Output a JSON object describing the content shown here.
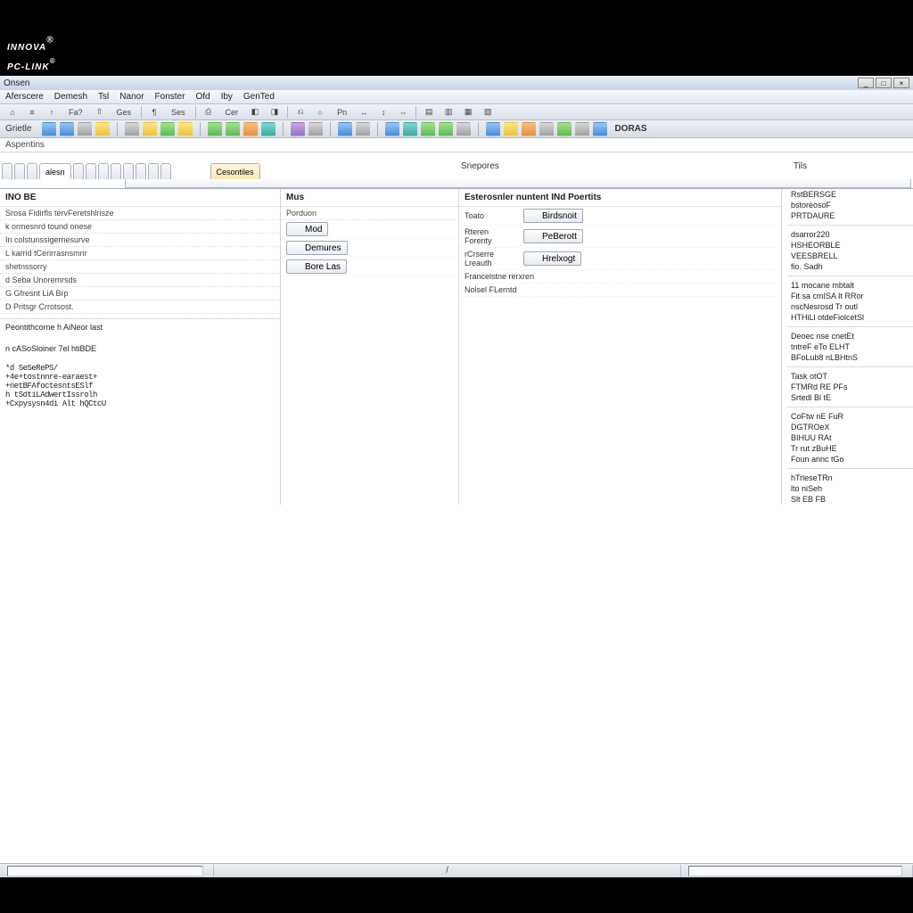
{
  "logo": {
    "line1": "INNOVA",
    "line2": "PC-LINK",
    "reg": "®",
    "sub": "®"
  },
  "window": {
    "title": "Onsen",
    "controls": {
      "min": "_",
      "max": "□",
      "close": "×"
    }
  },
  "menu": [
    "Aferscere",
    "Demesh",
    "Tsl",
    "Nanor",
    "Fonster",
    "Ofd",
    "Iby",
    "GenTed"
  ],
  "toolbar1": [
    {
      "label": "⌂"
    },
    {
      "label": "≡"
    },
    {
      "label": "↑"
    },
    {
      "label": "Fa?",
      "wide": true
    },
    {
      "label": "⇧"
    },
    {
      "label": "Ges",
      "wide": true
    },
    {
      "label": "|"
    },
    {
      "label": "¶"
    },
    {
      "label": "Ses",
      "wide": true
    },
    {
      "label": "|"
    },
    {
      "label": "⎙"
    },
    {
      "label": "Cer",
      "wide": true
    },
    {
      "label": "◧"
    },
    {
      "label": "◨"
    },
    {
      "label": "|"
    },
    {
      "label": "⎌"
    },
    {
      "label": "○"
    },
    {
      "label": "Pn",
      "wide": true
    },
    {
      "label": "↔"
    },
    {
      "label": "↕"
    },
    {
      "label": "⇔"
    },
    {
      "label": "|"
    },
    {
      "label": "▤"
    },
    {
      "label": "▥"
    },
    {
      "label": "▦"
    },
    {
      "label": "▧"
    }
  ],
  "toolbar2_label": "Grietle",
  "toolbar2_icons": [
    "i-blue",
    "i-blue",
    "i-gray",
    "i-yellow",
    "sep",
    "i-gray",
    "i-yellow",
    "i-green",
    "i-yellow",
    "sep",
    "i-green",
    "i-green",
    "i-orange",
    "i-teal",
    "sep",
    "i-purple",
    "i-gray",
    "sep",
    "i-blue",
    "i-gray",
    "sep",
    "i-blue",
    "i-teal",
    "i-green",
    "i-green",
    "i-gray",
    "sep",
    "i-blue",
    "i-yellow",
    "i-orange",
    "i-gray",
    "i-green",
    "i-gray",
    "i-blue"
  ],
  "toolbar2_end": "DORAS",
  "subheader": "Aspentins",
  "tabs": [
    {
      "label": "",
      "size": "small"
    },
    {
      "label": "",
      "size": "small"
    },
    {
      "label": "",
      "size": "small"
    },
    {
      "label": "alesn",
      "active": true
    },
    {
      "label": "",
      "size": "small"
    },
    {
      "label": "",
      "size": "small"
    },
    {
      "label": "",
      "size": "small"
    },
    {
      "label": "",
      "size": "small"
    },
    {
      "label": "",
      "size": "small"
    },
    {
      "label": "",
      "size": "small"
    },
    {
      "label": "",
      "size": "small"
    },
    {
      "label": "",
      "size": "small"
    }
  ],
  "tab_right": {
    "label": "Cesontiles",
    "highlighted": true
  },
  "col_headers": {
    "mid": "Snepores",
    "right": "Tils"
  },
  "left_panel": {
    "header": "INO BE",
    "sub": "Srosa Fidirfls tervFeretshlrisze",
    "items": [
      "k ormesnrd tound onese",
      "In colstunssigernesurve",
      "L karrid tCerirrasnsmnr",
      "shetnssorry",
      "d Seba Unoremrsds",
      "G Gfresnt LiA Brp",
      "D Pritsgr Crrotsost."
    ]
  },
  "mid1_panel": {
    "header": "Mus",
    "sub": "Porduon",
    "buttons": [
      {
        "label": "Mod",
        "color": "i-gray"
      },
      {
        "label": "Demures",
        "color": "i-green"
      },
      {
        "label": "Bore Las",
        "color": "i-teal"
      }
    ]
  },
  "mid2_panel": {
    "header": "Esterosnler nuntent INd Poertits",
    "rows": [
      {
        "l": "Toato",
        "btn": "Birdsnoit",
        "color": "i-green"
      },
      {
        "l": "Rteren Forenty",
        "btn": "PeBerott",
        "color": "i-green"
      },
      {
        "l": "rCrserre Lreauth",
        "btn": "Hrelxogt",
        "color": "i-green"
      }
    ],
    "trailing": [
      "Francelstne rerxren",
      "Nolsel FLerntd"
    ]
  },
  "right_panel": {
    "group1": [
      "RstBERSGE",
      "bstoreosoF",
      "PRTDAURE"
    ],
    "group2": [
      "dsarror220",
      "HSHEORBLE",
      "VEESBRELL",
      "fio. Sadh"
    ],
    "group3": [
      "11 mocane mbtalt",
      "Fit sa cmISA It RRor",
      "nscNesrosd Tr outl",
      "HTHiLl otdeFiolcetSl"
    ],
    "group4": [
      "Deoec nse cnetEt",
      "tntreF eTo ELHT",
      "BFoLub8 nLBHtnS"
    ],
    "group5": [
      "Task otOT",
      "FTMRd RE PFs",
      "Srtedl Bl tE"
    ],
    "group6": [
      "CoFtw nE FuR",
      "DGTROeX",
      "BIHUU RAt",
      "Tr rut zBuHE",
      "Foun annc tGo"
    ],
    "group7": [
      "hTrleseTRn",
      "lto niSeh",
      "Slt EB FB"
    ]
  },
  "lower_left": {
    "title1": "Peontithcorne h AiNeor last",
    "title2": "n cASoSloiner 7el htiBDE",
    "lines": [
      "*d SeSeRePS/",
      "+4e+tostnnre-earaest+",
      "+netBFAfoctesntsESlf",
      "h tSdtiLAdwertIssrolh",
      "+Cxpysysn4di Alt hQCtcU"
    ]
  },
  "statusbar": {
    "page": "/"
  }
}
